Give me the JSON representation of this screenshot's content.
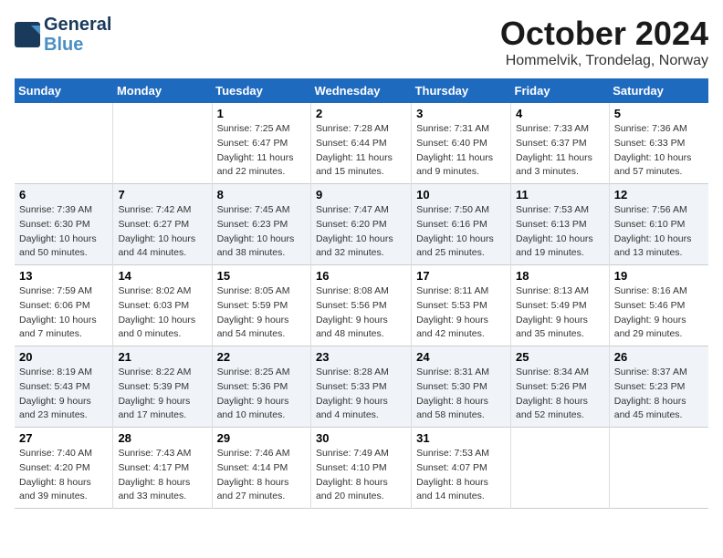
{
  "header": {
    "logo_line1": "General",
    "logo_line2": "Blue",
    "title": "October 2024",
    "subtitle": "Hommelvik, Trondelag, Norway"
  },
  "days_of_week": [
    "Sunday",
    "Monday",
    "Tuesday",
    "Wednesday",
    "Thursday",
    "Friday",
    "Saturday"
  ],
  "weeks": [
    [
      {
        "day": "",
        "sunrise": "",
        "sunset": "",
        "daylight": ""
      },
      {
        "day": "",
        "sunrise": "",
        "sunset": "",
        "daylight": ""
      },
      {
        "day": "1",
        "sunrise": "Sunrise: 7:25 AM",
        "sunset": "Sunset: 6:47 PM",
        "daylight": "Daylight: 11 hours and 22 minutes."
      },
      {
        "day": "2",
        "sunrise": "Sunrise: 7:28 AM",
        "sunset": "Sunset: 6:44 PM",
        "daylight": "Daylight: 11 hours and 15 minutes."
      },
      {
        "day": "3",
        "sunrise": "Sunrise: 7:31 AM",
        "sunset": "Sunset: 6:40 PM",
        "daylight": "Daylight: 11 hours and 9 minutes."
      },
      {
        "day": "4",
        "sunrise": "Sunrise: 7:33 AM",
        "sunset": "Sunset: 6:37 PM",
        "daylight": "Daylight: 11 hours and 3 minutes."
      },
      {
        "day": "5",
        "sunrise": "Sunrise: 7:36 AM",
        "sunset": "Sunset: 6:33 PM",
        "daylight": "Daylight: 10 hours and 57 minutes."
      }
    ],
    [
      {
        "day": "6",
        "sunrise": "Sunrise: 7:39 AM",
        "sunset": "Sunset: 6:30 PM",
        "daylight": "Daylight: 10 hours and 50 minutes."
      },
      {
        "day": "7",
        "sunrise": "Sunrise: 7:42 AM",
        "sunset": "Sunset: 6:27 PM",
        "daylight": "Daylight: 10 hours and 44 minutes."
      },
      {
        "day": "8",
        "sunrise": "Sunrise: 7:45 AM",
        "sunset": "Sunset: 6:23 PM",
        "daylight": "Daylight: 10 hours and 38 minutes."
      },
      {
        "day": "9",
        "sunrise": "Sunrise: 7:47 AM",
        "sunset": "Sunset: 6:20 PM",
        "daylight": "Daylight: 10 hours and 32 minutes."
      },
      {
        "day": "10",
        "sunrise": "Sunrise: 7:50 AM",
        "sunset": "Sunset: 6:16 PM",
        "daylight": "Daylight: 10 hours and 25 minutes."
      },
      {
        "day": "11",
        "sunrise": "Sunrise: 7:53 AM",
        "sunset": "Sunset: 6:13 PM",
        "daylight": "Daylight: 10 hours and 19 minutes."
      },
      {
        "day": "12",
        "sunrise": "Sunrise: 7:56 AM",
        "sunset": "Sunset: 6:10 PM",
        "daylight": "Daylight: 10 hours and 13 minutes."
      }
    ],
    [
      {
        "day": "13",
        "sunrise": "Sunrise: 7:59 AM",
        "sunset": "Sunset: 6:06 PM",
        "daylight": "Daylight: 10 hours and 7 minutes."
      },
      {
        "day": "14",
        "sunrise": "Sunrise: 8:02 AM",
        "sunset": "Sunset: 6:03 PM",
        "daylight": "Daylight: 10 hours and 0 minutes."
      },
      {
        "day": "15",
        "sunrise": "Sunrise: 8:05 AM",
        "sunset": "Sunset: 5:59 PM",
        "daylight": "Daylight: 9 hours and 54 minutes."
      },
      {
        "day": "16",
        "sunrise": "Sunrise: 8:08 AM",
        "sunset": "Sunset: 5:56 PM",
        "daylight": "Daylight: 9 hours and 48 minutes."
      },
      {
        "day": "17",
        "sunrise": "Sunrise: 8:11 AM",
        "sunset": "Sunset: 5:53 PM",
        "daylight": "Daylight: 9 hours and 42 minutes."
      },
      {
        "day": "18",
        "sunrise": "Sunrise: 8:13 AM",
        "sunset": "Sunset: 5:49 PM",
        "daylight": "Daylight: 9 hours and 35 minutes."
      },
      {
        "day": "19",
        "sunrise": "Sunrise: 8:16 AM",
        "sunset": "Sunset: 5:46 PM",
        "daylight": "Daylight: 9 hours and 29 minutes."
      }
    ],
    [
      {
        "day": "20",
        "sunrise": "Sunrise: 8:19 AM",
        "sunset": "Sunset: 5:43 PM",
        "daylight": "Daylight: 9 hours and 23 minutes."
      },
      {
        "day": "21",
        "sunrise": "Sunrise: 8:22 AM",
        "sunset": "Sunset: 5:39 PM",
        "daylight": "Daylight: 9 hours and 17 minutes."
      },
      {
        "day": "22",
        "sunrise": "Sunrise: 8:25 AM",
        "sunset": "Sunset: 5:36 PM",
        "daylight": "Daylight: 9 hours and 10 minutes."
      },
      {
        "day": "23",
        "sunrise": "Sunrise: 8:28 AM",
        "sunset": "Sunset: 5:33 PM",
        "daylight": "Daylight: 9 hours and 4 minutes."
      },
      {
        "day": "24",
        "sunrise": "Sunrise: 8:31 AM",
        "sunset": "Sunset: 5:30 PM",
        "daylight": "Daylight: 8 hours and 58 minutes."
      },
      {
        "day": "25",
        "sunrise": "Sunrise: 8:34 AM",
        "sunset": "Sunset: 5:26 PM",
        "daylight": "Daylight: 8 hours and 52 minutes."
      },
      {
        "day": "26",
        "sunrise": "Sunrise: 8:37 AM",
        "sunset": "Sunset: 5:23 PM",
        "daylight": "Daylight: 8 hours and 45 minutes."
      }
    ],
    [
      {
        "day": "27",
        "sunrise": "Sunrise: 7:40 AM",
        "sunset": "Sunset: 4:20 PM",
        "daylight": "Daylight: 8 hours and 39 minutes."
      },
      {
        "day": "28",
        "sunrise": "Sunrise: 7:43 AM",
        "sunset": "Sunset: 4:17 PM",
        "daylight": "Daylight: 8 hours and 33 minutes."
      },
      {
        "day": "29",
        "sunrise": "Sunrise: 7:46 AM",
        "sunset": "Sunset: 4:14 PM",
        "daylight": "Daylight: 8 hours and 27 minutes."
      },
      {
        "day": "30",
        "sunrise": "Sunrise: 7:49 AM",
        "sunset": "Sunset: 4:10 PM",
        "daylight": "Daylight: 8 hours and 20 minutes."
      },
      {
        "day": "31",
        "sunrise": "Sunrise: 7:53 AM",
        "sunset": "Sunset: 4:07 PM",
        "daylight": "Daylight: 8 hours and 14 minutes."
      },
      {
        "day": "",
        "sunrise": "",
        "sunset": "",
        "daylight": ""
      },
      {
        "day": "",
        "sunrise": "",
        "sunset": "",
        "daylight": ""
      }
    ]
  ]
}
